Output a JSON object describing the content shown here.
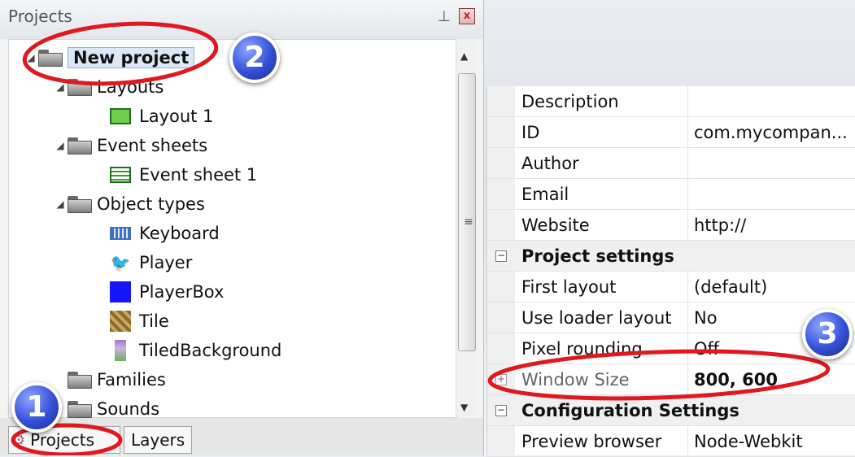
{
  "projects_panel": {
    "title": "Projects",
    "pin_icon": "pin-icon",
    "close_label": "x",
    "tree": {
      "project": "New project",
      "layouts_folder": "Layouts",
      "layout_1": "Layout 1",
      "event_sheets_folder": "Event sheets",
      "event_sheet_1": "Event sheet 1",
      "object_types_folder": "Object types",
      "objects": [
        "Keyboard",
        "Player",
        "PlayerBox",
        "Tile",
        "TiledBackground"
      ],
      "families_folder": "Families",
      "sounds_folder": "Sounds"
    },
    "tabs": [
      "Projects",
      "Layers"
    ]
  },
  "properties": {
    "rows": [
      {
        "name": "Description",
        "value": ""
      },
      {
        "name": "ID",
        "value": "com.mycompan..."
      },
      {
        "name": "Author",
        "value": ""
      },
      {
        "name": "Email",
        "value": ""
      },
      {
        "name": "Website",
        "value": "http://"
      }
    ],
    "project_settings": {
      "label": "Project settings",
      "rows": [
        {
          "name": "First layout",
          "value": "(default)"
        },
        {
          "name": "Use loader layout",
          "value": "No"
        },
        {
          "name": "Pixel rounding",
          "value": "Off"
        },
        {
          "name": "Window Size",
          "value": "800, 600"
        }
      ]
    },
    "configuration_settings": {
      "label": "Configuration Settings",
      "rows": [
        {
          "name": "Preview browser",
          "value": "Node-Webkit"
        }
      ]
    }
  },
  "callouts": [
    "1",
    "2",
    "3"
  ],
  "colors": {
    "annotation_red": "#e0191f",
    "callout_blue": "#3450d8",
    "selection_bg": "#dbe8f7"
  }
}
